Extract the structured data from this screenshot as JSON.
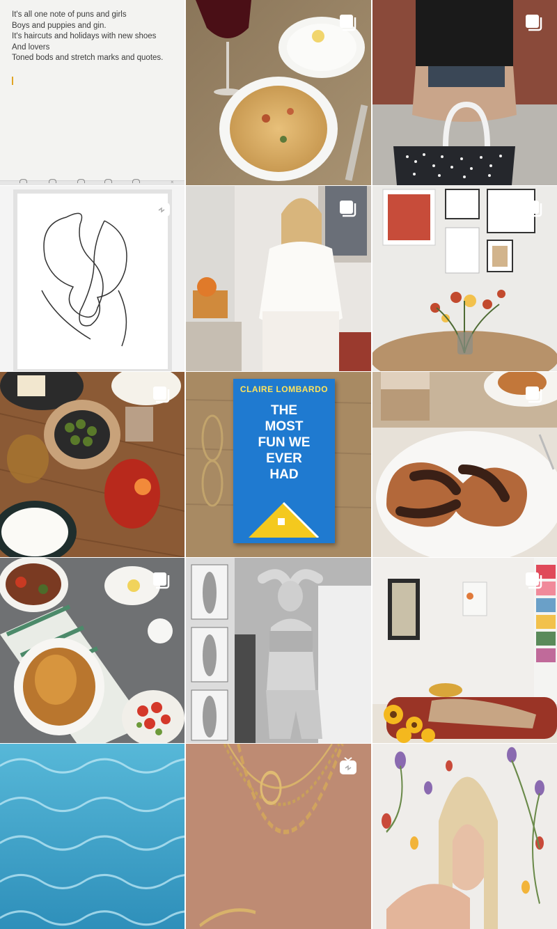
{
  "notes": {
    "lines": [
      "It's all one note of puns and girls",
      "Boys and puppies and gin.",
      "It's haircuts and holidays with new shoes",
      "And lovers",
      "Toned bods and stretch marks and quotes."
    ],
    "toolbar_icons": [
      "table-icon",
      "text-format-icon",
      "checklist-icon",
      "camera-icon",
      "markup-icon",
      "close-icon"
    ]
  },
  "book": {
    "author": "CLAIRE LOMBARDO",
    "title": "THE MOST FUN WE EVER HAD"
  },
  "colors": {
    "pasta_bg": "#9a8566",
    "street_bg": "#a38e7c",
    "lineart_bg": "#f4f4f4",
    "woman_room_bg": "#e9e6e2",
    "gallery_wall_bg": "#ecebe8",
    "drinks_table_bg": "#8b5a35",
    "wood_bg": "#a88a63",
    "pastry_bg": "#e7e1d8",
    "roast_bg": "#6f7173",
    "mono_bg": "#8e8e8e",
    "sofa_room_bg": "#f1efec",
    "pool_bg": "#3fa4c8",
    "necklace_bg": "#c4927a",
    "flowers_wall_bg": "#efedea"
  },
  "tiles": [
    {
      "name": "tile-notes-screenshot",
      "badge": ""
    },
    {
      "name": "tile-pasta-wine",
      "badge": "carousel-icon"
    },
    {
      "name": "tile-woman-handbag",
      "badge": "carousel-icon"
    },
    {
      "name": "tile-line-art-print",
      "badge": "igtv-icon"
    },
    {
      "name": "tile-woman-white-dress",
      "badge": "carousel-icon"
    },
    {
      "name": "tile-gallery-wall-flowers",
      "badge": "carousel-icon"
    },
    {
      "name": "tile-drinks-table",
      "badge": "carousel-icon"
    },
    {
      "name": "tile-book-glasses",
      "badge": ""
    },
    {
      "name": "tile-pastry-coffee",
      "badge": "carousel-icon"
    },
    {
      "name": "tile-roast-chicken",
      "badge": "carousel-icon"
    },
    {
      "name": "tile-mono-fitness",
      "badge": ""
    },
    {
      "name": "tile-woman-sofa-sunflowers",
      "badge": "carousel-icon"
    },
    {
      "name": "tile-pool-water",
      "badge": ""
    },
    {
      "name": "tile-gold-necklaces",
      "badge": "igtv-icon"
    },
    {
      "name": "tile-woman-flower-wall",
      "badge": ""
    }
  ]
}
